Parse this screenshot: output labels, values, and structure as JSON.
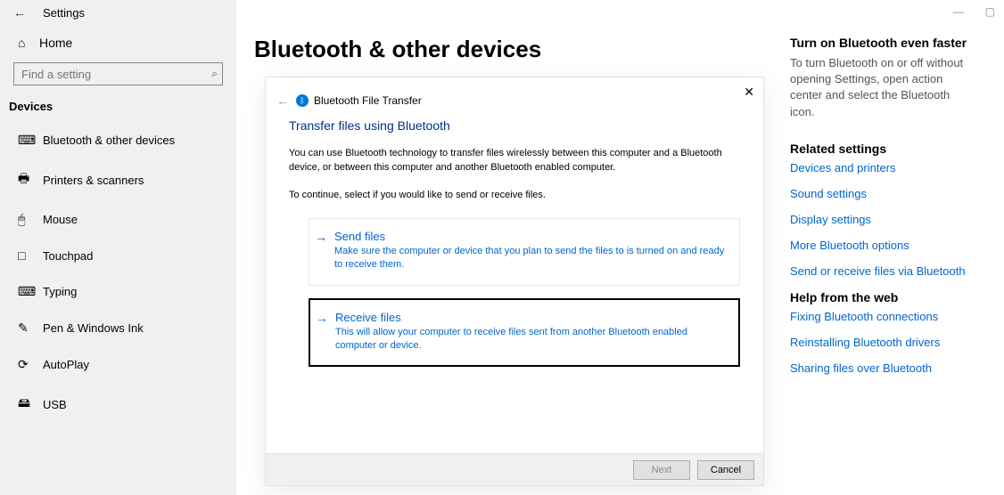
{
  "window": {
    "title": "Settings",
    "min_icon": "—",
    "max_icon": "▢"
  },
  "sidebar": {
    "home": "Home",
    "search_placeholder": "Find a setting",
    "section": "Devices",
    "items": [
      {
        "icon": "⌨",
        "label": "Bluetooth & other devices"
      },
      {
        "icon": "🖶",
        "label": "Printers & scanners"
      },
      {
        "icon": "🖱",
        "label": "Mouse"
      },
      {
        "icon": "□",
        "label": "Touchpad"
      },
      {
        "icon": "⌨",
        "label": "Typing"
      },
      {
        "icon": "✎",
        "label": "Pen & Windows Ink"
      },
      {
        "icon": "⟳",
        "label": "AutoPlay"
      },
      {
        "icon": "🖴",
        "label": "USB"
      }
    ]
  },
  "main": {
    "heading": "Bluetooth & other devices"
  },
  "right": {
    "tip_heading": "Turn on Bluetooth even faster",
    "tip_text": "To turn Bluetooth on or off without opening Settings, open action center and select the Bluetooth icon.",
    "related_heading": "Related settings",
    "related_links": [
      "Devices and printers",
      "Sound settings",
      "Display settings",
      "More Bluetooth options",
      "Send or receive files via Bluetooth"
    ],
    "help_heading": "Help from the web",
    "help_links": [
      "Fixing Bluetooth connections",
      "Reinstalling Bluetooth drivers",
      "Sharing files over Bluetooth"
    ]
  },
  "wizard": {
    "title": "Bluetooth File Transfer",
    "heading": "Transfer files using Bluetooth",
    "intro": "You can use Bluetooth technology to transfer files wirelessly between this computer and a Bluetooth device, or between this computer and another Bluetooth enabled computer.",
    "continue": "To continue, select if you would like to send or receive files.",
    "send": {
      "title": "Send files",
      "desc": "Make sure the computer or device that you plan to send the files to is turned on and ready to receive them."
    },
    "receive": {
      "title": "Receive files",
      "desc": "This will allow your computer to receive files sent from another Bluetooth enabled computer or device."
    },
    "next": "Next",
    "cancel": "Cancel"
  }
}
